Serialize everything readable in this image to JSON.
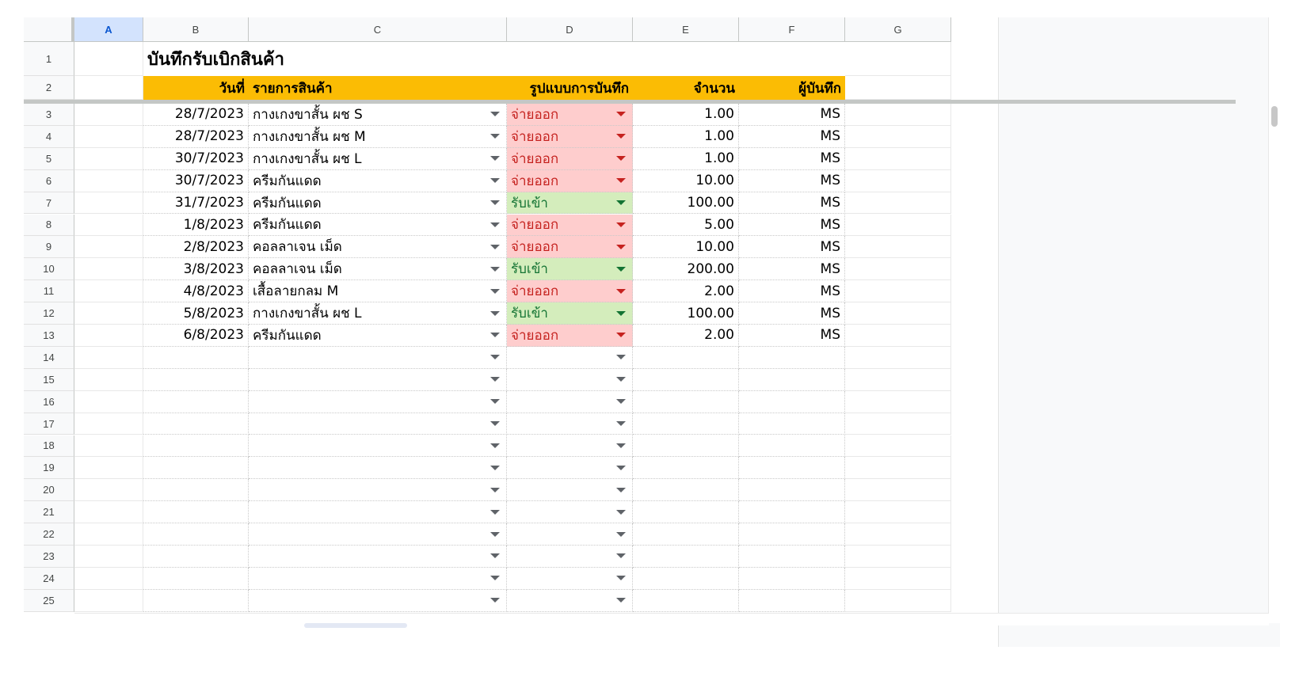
{
  "columns": [
    "A",
    "B",
    "C",
    "D",
    "E",
    "F",
    "G"
  ],
  "selected_column": "A",
  "row_numbers": [
    "1",
    "2",
    "3",
    "4",
    "5",
    "6",
    "7",
    "8",
    "9",
    "10",
    "11",
    "12",
    "13",
    "14",
    "15",
    "16",
    "17",
    "18",
    "19",
    "20",
    "21",
    "22",
    "23",
    "24",
    "25"
  ],
  "sheet_title": "บันทึกรับเบิกสินค้า",
  "headers": {
    "date": "วันที่",
    "item": "รายการสินค้า",
    "type": "รูปแบบการบันทึก",
    "qty": "จำนวน",
    "recorder": "ผู้บันทึก"
  },
  "rows": [
    {
      "date": "28/7/2023",
      "item": "กางเกงขาสั้น ผช S",
      "type": "จ่ายออก",
      "qty": "1.00",
      "recorder": "MS"
    },
    {
      "date": "28/7/2023",
      "item": "กางเกงขาสั้น ผช M",
      "type": "จ่ายออก",
      "qty": "1.00",
      "recorder": "MS"
    },
    {
      "date": "30/7/2023",
      "item": "กางเกงขาสั้น ผช L",
      "type": "จ่ายออก",
      "qty": "1.00",
      "recorder": "MS"
    },
    {
      "date": "30/7/2023",
      "item": "ครีมกันแดด",
      "type": "จ่ายออก",
      "qty": "10.00",
      "recorder": "MS"
    },
    {
      "date": "31/7/2023",
      "item": "ครีมกันแดด",
      "type": "รับเข้า",
      "qty": "100.00",
      "recorder": "MS"
    },
    {
      "date": "1/8/2023",
      "item": "ครีมกันแดด",
      "type": "จ่ายออก",
      "qty": "5.00",
      "recorder": "MS"
    },
    {
      "date": "2/8/2023",
      "item": "คอลลาเจน เม็ด",
      "type": "จ่ายออก",
      "qty": "10.00",
      "recorder": "MS"
    },
    {
      "date": "3/8/2023",
      "item": "คอลลาเจน เม็ด",
      "type": "รับเข้า",
      "qty": "200.00",
      "recorder": "MS"
    },
    {
      "date": "4/8/2023",
      "item": "เสื้อลายกลม M",
      "type": "จ่ายออก",
      "qty": "2.00",
      "recorder": "MS"
    },
    {
      "date": "5/8/2023",
      "item": "กางเกงขาสั้น ผช L",
      "type": "รับเข้า",
      "qty": "100.00",
      "recorder": "MS"
    },
    {
      "date": "6/8/2023",
      "item": "ครีมกันแดด",
      "type": "จ่ายออก",
      "qty": "2.00",
      "recorder": "MS"
    }
  ],
  "empty_row_count": 12,
  "colors": {
    "header_fill": "#fbbc04",
    "out_fill": "#fecdcd",
    "out_text": "#c5221f",
    "in_fill": "#d4edbc",
    "in_text": "#137333",
    "selected_column_fill": "#d3e3fd"
  },
  "type_values": {
    "out": "จ่ายออก",
    "in": "รับเข้า"
  }
}
